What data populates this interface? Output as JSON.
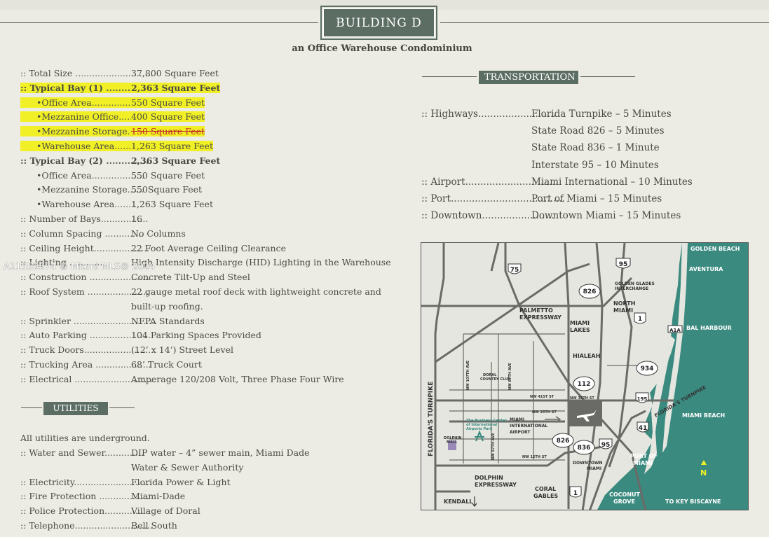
{
  "header": {
    "building_title": "BUILDING D",
    "subtitle": "an Office Warehouse Condominium"
  },
  "specs": [
    {
      "label": ":: Total Size ",
      "dots": "............................",
      "value": "37,800  Square Feet"
    },
    {
      "label": ":: Typical Bay (1) ",
      "dots": "...............",
      "value": "2,363 Square Feet"
    },
    {
      "label": "•Office Area",
      "dots": "...................",
      "value": "550 Square Feet"
    },
    {
      "label": "•Mezzanine Office",
      "dots": ".......",
      "value": "400 Square Feet"
    },
    {
      "label": "•Mezzanine Storage",
      "dots": "......",
      "value": "150 Square Feet"
    },
    {
      "label": "•Warehouse Area",
      "dots": ".........",
      "value": "1,263 Square Feet"
    },
    {
      "label": ":: Typical Bay (2) ",
      "dots": "..............",
      "value": "2,363 Square Feet"
    },
    {
      "label": "•Office Area",
      "dots": "...................",
      "value": "550 Square Feet"
    },
    {
      "label": "•Mezzanine Storage",
      "dots": "......",
      "value": "550Square Feet"
    },
    {
      "label": "•Warehouse Area",
      "dots": ".........",
      "value": "1,263 Square Feet"
    },
    {
      "label": ":: Number of Bays",
      "dots": ".................",
      "value": "16"
    },
    {
      "label": ":: Column Spacing ",
      "dots": "..............",
      "value": "No Columns"
    },
    {
      "label": ":: Ceiling Height",
      "dots": "....................",
      "value": "22 Foot Average Ceiling Clearance"
    },
    {
      "label": ":: Lighting ",
      "dots": "............",
      "value": "High Intensity Discharge (HID) Lighting in the Warehouse"
    },
    {
      "label": ":: Construction ",
      "dots": "......................",
      "value": "Concrete Tilt-Up and Steel"
    },
    {
      "label": ":: Roof System ",
      "dots": "......................",
      "value": "22 gauge metal roof deck with lightweight concrete and"
    },
    {
      "label": "",
      "dots": "",
      "value": "built-up roofing."
    },
    {
      "label": ":: Sprinkler ",
      "dots": "..............................",
      "value": "NFPA Standards"
    },
    {
      "label": ":: Auto Parking ",
      "dots": "......................",
      "value": "104 Parking Spaces Provided"
    },
    {
      "label": ":: Truck Doors",
      "dots": "........................",
      "value": "(12’ x 14’) Street Level"
    },
    {
      "label": ":: Trucking Area ",
      "dots": "....................",
      "value": "68’ Truck Court"
    },
    {
      "label": ":: Electrical ",
      "dots": ".............................",
      "value": "Amperage 120/208 Volt, Three Phase Four Wire"
    }
  ],
  "utilities": {
    "title": "UTILITIES",
    "intro": "All utilities are underground.",
    "rows": [
      {
        "label": ":: Water and Sewer",
        "dots": "..............",
        "value": "DIP water – 4” sewer main, Miami Dade"
      },
      {
        "label": "",
        "dots": "",
        "value": "Water & Sewer Authority"
      },
      {
        "label": ":: Electricity",
        "dots": "............................",
        "value": "Florida Power & Light"
      },
      {
        "label": ":: Fire Protection ",
        "dots": "..................",
        "value": "Miami-Dade"
      },
      {
        "label": ":: Police Protection",
        "dots": "..............",
        "value": "Village of Doral"
      },
      {
        "label": ":: Telephone",
        "dots": "............................",
        "value": "Bell South"
      }
    ]
  },
  "transportation": {
    "title": "TRANSPORTATION",
    "rows": [
      {
        "label": ":: Highways",
        "dots": "..........................",
        "value": "Florida Turnpike – 5 Minutes"
      },
      {
        "label": "",
        "dots": "",
        "value": "State Road 826 – 5 Minutes"
      },
      {
        "label": "",
        "dots": "",
        "value": "State Road 836 – 1 Minute"
      },
      {
        "label": "",
        "dots": "",
        "value": "Interstate 95 – 10 Minutes"
      },
      {
        "label": ":: Airport",
        "dots": "...............................",
        "value": "Miami International – 10 Minutes"
      },
      {
        "label": ":: Port",
        "dots": "......................................",
        "value": "Port of Miami – 15 Minutes"
      },
      {
        "label": ":: Downtown",
        "dots": "........................",
        "value": "Downtown Miami – 15 Minutes"
      }
    ]
  },
  "watermark": "A11552674 © Miami MLS® 2024",
  "map": {
    "labels": {
      "golden_beach": "GOLDEN BEACH",
      "aventura": "AVENTURA",
      "golden_glades": "GOLDEN GLADES",
      "interchange": "INTERCHANGE",
      "north_miami_1": "NORTH",
      "north_miami_2": "MIAMI",
      "bal_harbour": "BAL HARBOUR",
      "palmetto_1": "PALMETTO",
      "palmetto_2": "EXPRESSWAY",
      "miami_lakes_1": "MIAMI",
      "miami_lakes_2": "LAKES",
      "hialeah": "HIALEAH",
      "florida_turnpike_diag": "FLORIDA'S TURNPIKE",
      "florida_turnpike_vert": "FLORIDA'S TURNPIKE",
      "doral_cc_1": "DORAL",
      "doral_cc_2": "COUNTRY CLUB",
      "nw107": "NW 107TH AVE",
      "nw87": "NW 87TH AVE",
      "nw41": "NW 41ST ST",
      "nw36": "NW 36TH ST",
      "nw25": "NW 25TH ST",
      "nw12": "NW 12TH ST",
      "nw97": "NW 97TH AVE",
      "business_center_1": "The Business Center",
      "business_center_2": "of International",
      "business_center_3": "Airports Park",
      "dolphin_mall_1": "DOLPHIN",
      "dolphin_mall_2": "MALL",
      "mia_1": "MIAMI",
      "mia_2": "INTERNATIONAL",
      "mia_3": "AIRPORT",
      "miami_beach": "MIAMI BEACH",
      "downtown_1": "DOWNTOWN",
      "downtown_2": "MIAMI",
      "port_1": "PORT OF",
      "port_2": "MIAMI",
      "dolphin_exp_1": "DOLPHIN",
      "dolphin_exp_2": "EXPRESSWAY",
      "coral_1": "CORAL",
      "coral_2": "GABLES",
      "kendall": "KENDALL",
      "coconut_1": "COCONUT",
      "coconut_2": "GROVE",
      "key_biscayne": "TO KEY BISCAYNE",
      "north": "N"
    },
    "shields": {
      "i75": "75",
      "i95_top": "95",
      "r826_top": "826",
      "us1_top": "1",
      "a1a": "A1A",
      "r934": "934",
      "r112": "112",
      "i195": "195",
      "r41": "41",
      "r826": "826",
      "r836": "836",
      "i95": "95",
      "us1": "1"
    },
    "colors": {
      "water": "#3a8a80",
      "roads": "#6a6a66",
      "land": "#e6e6e0"
    }
  }
}
